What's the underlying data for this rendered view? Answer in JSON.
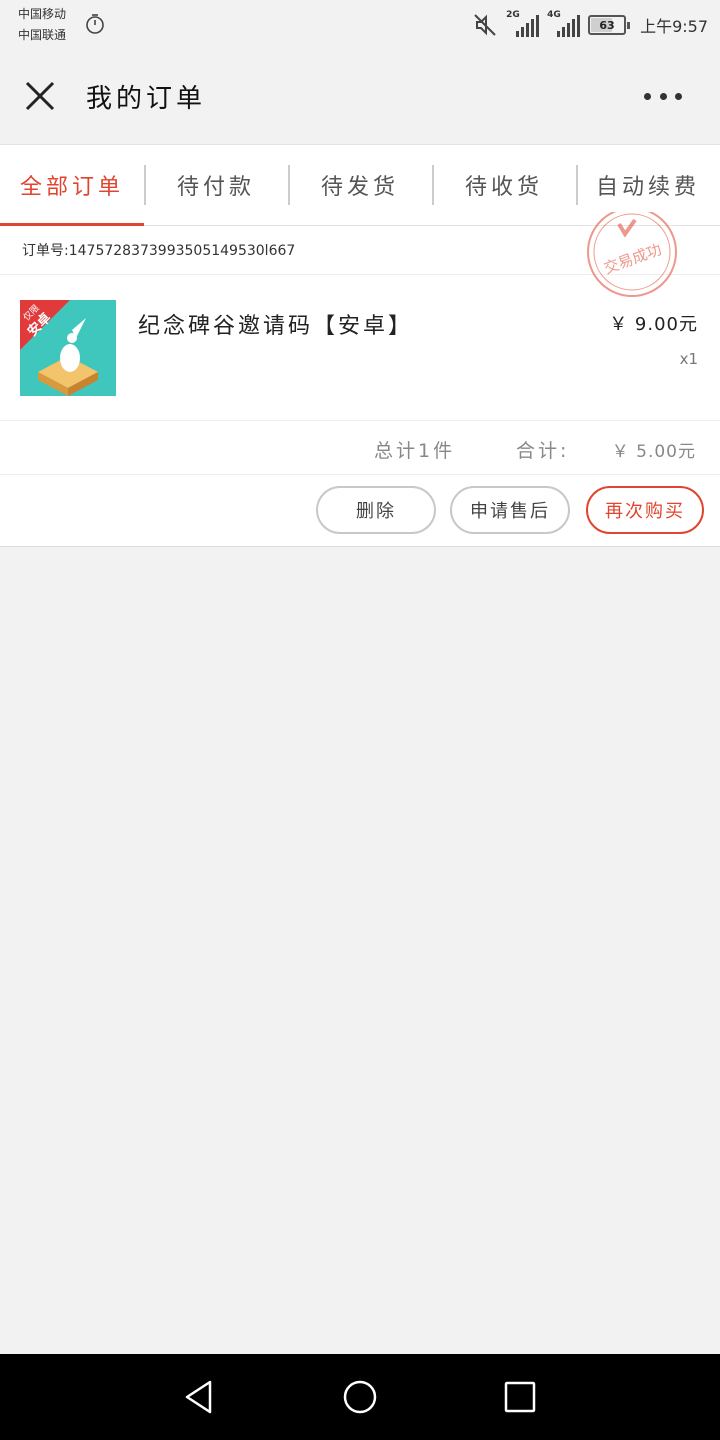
{
  "status_bar": {
    "carrier_1": "中国移动",
    "carrier_2": "中国联通",
    "signal_1": "2G",
    "signal_2": "4G",
    "battery": "63",
    "time": "上午9:57"
  },
  "header": {
    "title": "我的订单",
    "close_icon": "close-icon",
    "more_icon": "more-icon"
  },
  "tabs": [
    {
      "label": "全部订单",
      "active": true
    },
    {
      "label": "待付款",
      "active": false
    },
    {
      "label": "待发货",
      "active": false
    },
    {
      "label": "待收货",
      "active": false
    },
    {
      "label": "自动续费",
      "active": false
    }
  ],
  "order": {
    "order_no": "订单号:1475728373993505149530l667",
    "stamp_text": "交易成功",
    "product": {
      "badge_top": "仅限",
      "badge_bottom": "安卓",
      "name": "纪念碑谷邀请码【安卓】",
      "price": "￥ 9.00元",
      "qty": "x1"
    },
    "summary": {
      "count": "总计1件",
      "total_label": "合计:",
      "total": "￥ 5.00元"
    },
    "actions": {
      "delete": "删除",
      "after_sale": "申请售后",
      "rebuy": "再次购买"
    }
  },
  "colors": {
    "accent": "#e0452f",
    "background": "#f2f2f2"
  }
}
